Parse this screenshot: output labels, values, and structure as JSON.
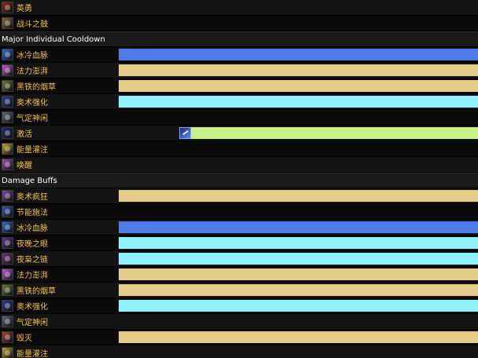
{
  "colors": {
    "name_text": "#f2c14e",
    "header_text": "#ffffff",
    "bar_blue": "#4e7be8",
    "bar_tan": "#e4cb86",
    "bar_cyan": "#8ff3ff",
    "bar_green": "#c9f08a"
  },
  "rows": [
    {
      "kind": "ability",
      "label": "英勇",
      "icon": "heroism-icon",
      "icon_color": "#8b2a1a"
    },
    {
      "kind": "ability",
      "label": "战斗之鼓",
      "icon": "war-drums-icon",
      "icon_color": "#8a6a3a"
    },
    {
      "kind": "header",
      "label": "Major Individual Cooldown"
    },
    {
      "kind": "ability",
      "label": "冰冷血脉",
      "icon": "icy-veins-icon",
      "icon_color": "#2c6fd6",
      "bar": {
        "start_frac": 0.0,
        "end_frac": 1.0,
        "color": "bar_blue"
      }
    },
    {
      "kind": "ability",
      "label": "法力澎湃",
      "icon": "power-surge-icon",
      "icon_color": "#c45bd6",
      "bar": {
        "start_frac": 0.0,
        "end_frac": 1.0,
        "color": "bar_tan"
      }
    },
    {
      "kind": "ability",
      "label": "黑铁的烟草",
      "icon": "dark-iron-tobacco-icon",
      "icon_color": "#6a7a3a",
      "bar": {
        "start_frac": 0.0,
        "end_frac": 1.0,
        "color": "bar_tan"
      }
    },
    {
      "kind": "ability",
      "label": "奥术强化",
      "icon": "arcane-power-icon",
      "icon_color": "#2a3f9c",
      "bar": {
        "start_frac": 0.0,
        "end_frac": 1.0,
        "color": "bar_cyan"
      }
    },
    {
      "kind": "ability",
      "label": "气定神闲",
      "icon": "presence-of-mind-icon",
      "icon_color": "#5a6a7a"
    },
    {
      "kind": "ability",
      "label": "激活",
      "icon": "innervate-icon",
      "icon_color": "#1c2a6e",
      "bar": {
        "start_frac": 0.1693,
        "end_frac": 1.0,
        "color": "bar_green",
        "leading_icon": "innervate-icon"
      }
    },
    {
      "kind": "ability",
      "label": "能量灌注",
      "icon": "power-infusion-icon",
      "icon_color": "#c8a030"
    },
    {
      "kind": "ability",
      "label": "唤醒",
      "icon": "evocation-icon",
      "icon_color": "#a050c0"
    },
    {
      "kind": "header",
      "label": "Damage Buffs"
    },
    {
      "kind": "ability",
      "label": "奥术疯狂",
      "icon": "arcane-madness-icon",
      "icon_color": "#7a4aa8",
      "bar": {
        "start_frac": 0.0,
        "end_frac": 1.0,
        "color": "bar_tan"
      }
    },
    {
      "kind": "ability",
      "label": "节能施法",
      "icon": "clearcasting-icon",
      "icon_color": "#3a5ab0"
    },
    {
      "kind": "ability",
      "label": "冰冷血脉",
      "icon": "icy-veins-icon",
      "icon_color": "#2c6fd6",
      "bar": {
        "start_frac": 0.0,
        "end_frac": 1.0,
        "color": "bar_blue"
      }
    },
    {
      "kind": "ability",
      "label": "夜晚之眼",
      "icon": "eye-of-the-night-icon",
      "icon_color": "#5a3a8a",
      "bar": {
        "start_frac": 0.0,
        "end_frac": 1.0,
        "color": "bar_cyan"
      }
    },
    {
      "kind": "ability",
      "label": "夜枭之链",
      "icon": "chain-of-the-twilight-owl-icon",
      "icon_color": "#6a3a7a",
      "bar": {
        "start_frac": 0.0,
        "end_frac": 1.0,
        "color": "bar_cyan"
      }
    },
    {
      "kind": "ability",
      "label": "法力澎湃",
      "icon": "power-surge-icon",
      "icon_color": "#c45bd6",
      "bar": {
        "start_frac": 0.0,
        "end_frac": 1.0,
        "color": "bar_tan"
      }
    },
    {
      "kind": "ability",
      "label": "黑铁的烟草",
      "icon": "dark-iron-tobacco-icon",
      "icon_color": "#6a7a3a",
      "bar": {
        "start_frac": 0.0,
        "end_frac": 1.0,
        "color": "bar_tan"
      }
    },
    {
      "kind": "ability",
      "label": "奥术强化",
      "icon": "arcane-power-icon",
      "icon_color": "#2a3f9c",
      "bar": {
        "start_frac": 0.0,
        "end_frac": 1.0,
        "color": "bar_cyan"
      }
    },
    {
      "kind": "ability",
      "label": "气定神闲",
      "icon": "presence-of-mind-icon",
      "icon_color": "#5a6a7a"
    },
    {
      "kind": "ability",
      "label": "毁灭",
      "icon": "destruction-icon",
      "icon_color": "#b0402a",
      "bar": {
        "start_frac": 0.0,
        "end_frac": 1.0,
        "color": "bar_tan"
      }
    },
    {
      "kind": "ability",
      "label": "能量灌注",
      "icon": "power-infusion-icon",
      "icon_color": "#c8a030"
    }
  ]
}
